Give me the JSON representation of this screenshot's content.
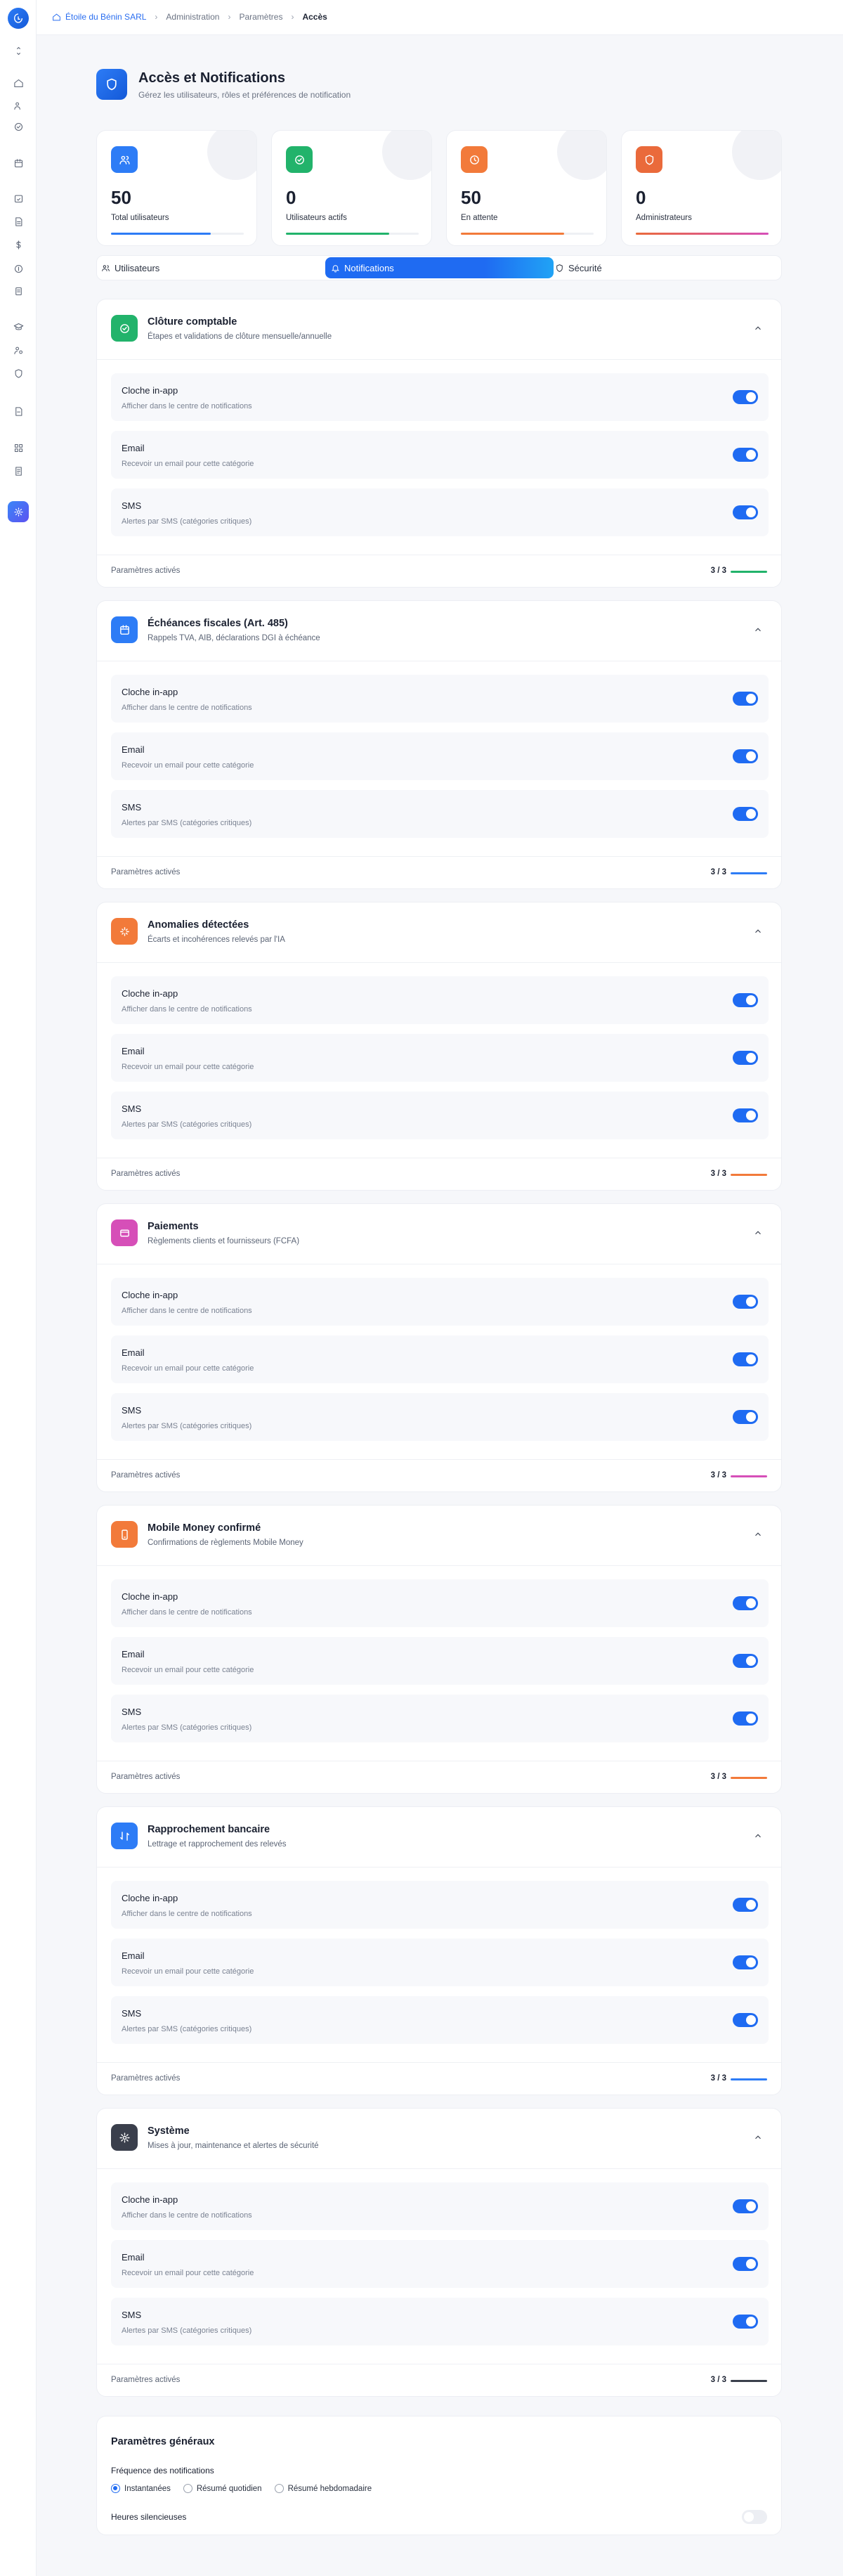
{
  "breadcrumb": {
    "home": "Étoile du Bénin SARL",
    "items": [
      "Administration",
      "Paramètres"
    ],
    "current": "Accès"
  },
  "header": {
    "title": "Accès et Notifications",
    "subtitle": "Gérez les utilisateurs, rôles et préférences de notification"
  },
  "stats": [
    {
      "value": "50",
      "label": "Total utilisateurs",
      "icon": "users-icon",
      "color": "#2d7cf6",
      "progress": 0.75
    },
    {
      "value": "0",
      "label": "Utilisateurs actifs",
      "icon": "check-circle-icon",
      "color": "#22b36b",
      "progress": 0.78
    },
    {
      "value": "50",
      "label": "En attente",
      "icon": "clock-icon",
      "color": "#f27a3a",
      "progress": 0.78
    },
    {
      "value": "0",
      "label": "Administrateurs",
      "icon": "shield-icon",
      "color": "#ea6a3b",
      "progress": 1.0
    }
  ],
  "tabs": [
    {
      "label": "Utilisateurs",
      "icon": "users-icon"
    },
    {
      "label": "Notifications",
      "icon": "bell-icon",
      "active": true
    },
    {
      "label": "Sécurité",
      "icon": "shield-icon"
    }
  ],
  "channels": [
    {
      "title": "Cloche in-app",
      "sub": "Afficher dans le centre de notifications"
    },
    {
      "title": "Email",
      "sub": "Recevoir un email pour cette catégorie"
    },
    {
      "title": "SMS",
      "sub": "Alertes par SMS (catégories critiques)"
    }
  ],
  "categories": [
    {
      "title": "Clôture comptable",
      "sub": "Étapes et validations de clôture mensuelle/annuelle",
      "icon": "check-circle-icon",
      "color": "#22b36b",
      "count": "3 / 3"
    },
    {
      "title": "Échéances fiscales (Art. 485)",
      "sub": "Rappels TVA, AIB, déclarations DGI à échéance",
      "icon": "calendar-icon",
      "color": "#2d7cf6",
      "count": "3 / 3"
    },
    {
      "title": "Anomalies détectées",
      "sub": "Écarts et incohérences relevés par l'IA",
      "icon": "sparkle-icon",
      "color": "#f27a3a",
      "count": "3 / 3"
    },
    {
      "title": "Paiements",
      "sub": "Règlements clients et fournisseurs (FCFA)",
      "icon": "card-icon",
      "color": "#d64fb8",
      "count": "3 / 3"
    },
    {
      "title": "Mobile Money confirmé",
      "sub": "Confirmations de règlements Mobile Money",
      "icon": "phone-icon",
      "color": "#f27a3a",
      "count": "3 / 3"
    },
    {
      "title": "Rapprochement bancaire",
      "sub": "Lettrage et rapprochement des relevés",
      "icon": "swap-icon",
      "color": "#2d7cf6",
      "count": "3 / 3"
    },
    {
      "title": "Système",
      "sub": "Mises à jour, maintenance et alertes de sécurité",
      "icon": "gear-icon",
      "color": "#3a3f4c",
      "count": "3 / 3"
    }
  ],
  "footer_label": "Paramètres activés",
  "general": {
    "title": "Paramètres généraux",
    "frequency_label": "Fréquence des notifications",
    "options": [
      "Instantanées",
      "Résumé quotidien",
      "Résumé hebdomadaire"
    ],
    "selected": "Instantanées",
    "quiet_hours": "Heures silencieuses"
  }
}
